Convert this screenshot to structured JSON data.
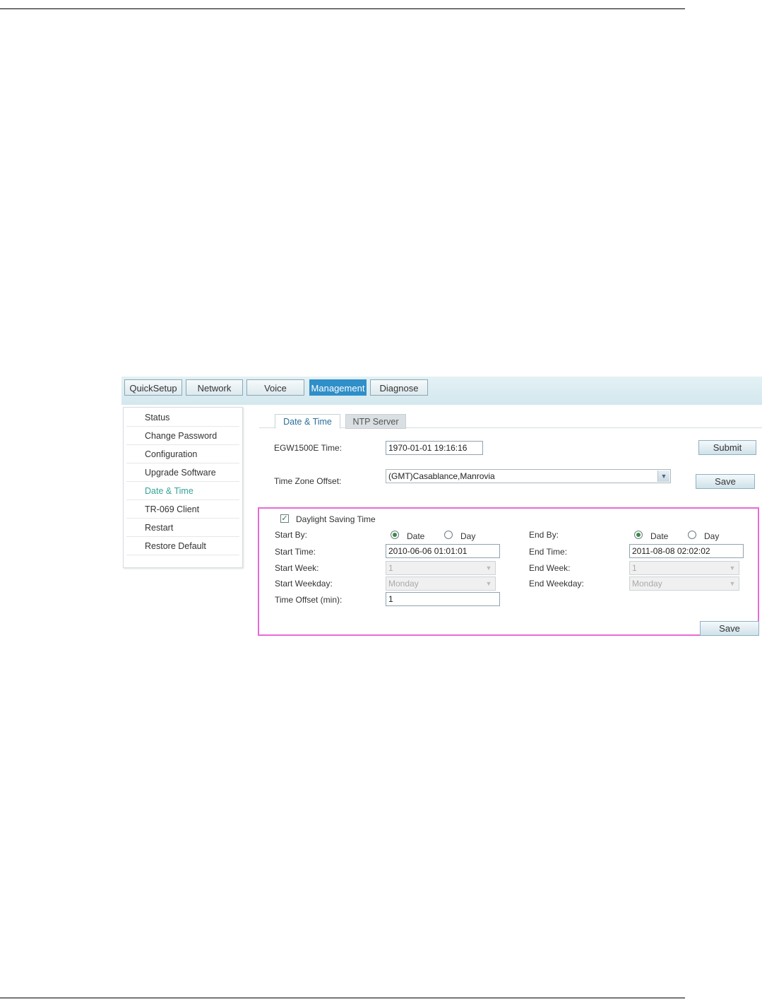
{
  "top_nav": [
    "QuickSetup",
    "Network",
    "Voice",
    "Management",
    "Diagnose"
  ],
  "active_top_nav": "Management",
  "sidebar": {
    "items": [
      "Status",
      "Change Password",
      "Configuration",
      "Upgrade Software",
      "Date & Time",
      "TR-069 Client",
      "Restart",
      "Restore Default"
    ],
    "active": "Date & Time"
  },
  "tabs": [
    "Date & Time",
    "NTP Server"
  ],
  "form": {
    "device_time_label": "EGW1500E Time:",
    "device_time_value": "1970-01-01 19:16:16",
    "submit_label": "Submit",
    "timezone_label": "Time Zone Offset:",
    "timezone_value": "(GMT)Casablance,Manrovia",
    "save_label": "Save"
  },
  "dst": {
    "enabled_label": "Daylight Saving Time",
    "enabled": true,
    "start_by_label": "Start By:",
    "end_by_label": "End By:",
    "option_date": "Date",
    "option_day": "Day",
    "start_by": "Date",
    "end_by": "Date",
    "start_time_label": "Start Time:",
    "start_time_value": "2010-06-06 01:01:01",
    "end_time_label": "End Time:",
    "end_time_value": "2011-08-08 02:02:02",
    "start_week_label": "Start Week:",
    "start_week_value": "1",
    "end_week_label": "End Week:",
    "end_week_value": "1",
    "start_weekday_label": "Start Weekday:",
    "start_weekday_value": "Monday",
    "end_weekday_label": "End Weekday:",
    "end_weekday_value": "Monday",
    "time_offset_label": "Time Offset (min):",
    "time_offset_value": "1",
    "save_label": "Save"
  },
  "colors": {
    "active_nav_bg": "#2f8fc9",
    "active_sidebar_text": "#35a39a",
    "highlight_border": "#e86ad6"
  }
}
